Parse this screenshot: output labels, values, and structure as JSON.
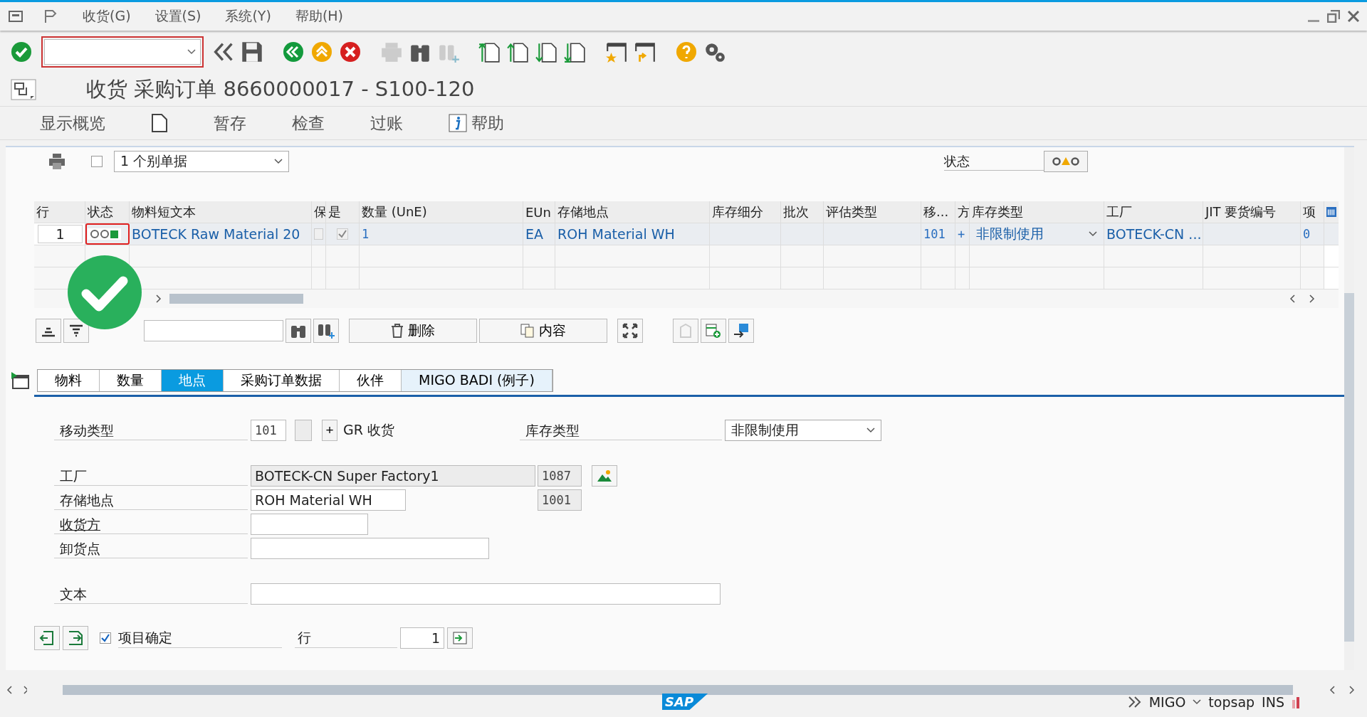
{
  "menu": [
    "收货(G)",
    "设置(S)",
    "系统(Y)",
    "帮助(H)"
  ],
  "title": "收货 采购订单 8660000017 - S100-120",
  "app_toolbar": [
    {
      "kind": "text",
      "label": "显示概览"
    },
    {
      "kind": "doc"
    },
    {
      "kind": "text",
      "label": "暂存"
    },
    {
      "kind": "text",
      "label": "检查"
    },
    {
      "kind": "text",
      "label": "过账"
    },
    {
      "kind": "help",
      "label": "帮助"
    }
  ],
  "header": {
    "print_checkbox": {
      "checked": false
    },
    "document_select": "1 个别单据",
    "status_label": "状态"
  },
  "table": {
    "columns": [
      "行",
      "状态",
      "物料短文本",
      "保",
      "是",
      "数量 (UnE)",
      "EUn",
      "存储地点",
      "库存细分",
      "批次",
      "评估类型",
      "移...",
      "方",
      "库存类型",
      "工厂",
      "JIT 要货编号",
      "项"
    ],
    "rows": [
      {
        "cells": [
          {
            "kind": "num",
            "text": "1"
          },
          {
            "kind": "status",
            "color": "#1a9a3a"
          },
          {
            "kind": "link",
            "text": "BOTECK Raw Material 20"
          },
          {
            "kind": "check",
            "checked": false
          },
          {
            "kind": "check",
            "checked": true
          },
          {
            "kind": "value",
            "text": "1"
          },
          {
            "kind": "link",
            "text": "EA"
          },
          {
            "kind": "link",
            "text": "ROH Material WH"
          },
          {
            "kind": "blank"
          },
          {
            "kind": "blank"
          },
          {
            "kind": "blank"
          },
          {
            "kind": "value",
            "text": "101"
          },
          {
            "kind": "value",
            "text": "+"
          },
          {
            "kind": "dropdown",
            "text": "非限制使用"
          },
          {
            "kind": "link",
            "text": "BOTECK-CN ..."
          },
          {
            "kind": "blank"
          },
          {
            "kind": "value",
            "text": "0"
          }
        ]
      }
    ]
  },
  "table_toolbar": [
    "删除",
    "内容"
  ],
  "tabs": [
    {
      "label": "物料",
      "selected": false
    },
    {
      "label": "数量",
      "selected": false
    },
    {
      "label": "地点",
      "selected": true
    },
    {
      "label": "采购订单数据",
      "selected": false
    },
    {
      "label": "伙伴",
      "selected": false
    },
    {
      "label": "MIGO BADI (例子)",
      "selected": false
    }
  ],
  "form": {
    "movement_type": {
      "label": "移动类型",
      "value": "101",
      "indicator": "+",
      "description": "GR 收货"
    },
    "stock_type": {
      "label": "库存类型",
      "value": "非限制使用"
    },
    "plant": {
      "label": "工厂",
      "value": "BOTECK-CN Super Factory1",
      "code": "1087"
    },
    "storage_location": {
      "label": "存储地点",
      "value": "ROH Material WH",
      "code": "1001"
    },
    "goods_recipient": {
      "label": "收货方"
    },
    "unloading_point": {
      "label": "卸货点"
    },
    "text": {
      "label": "文本"
    }
  },
  "footer": {
    "item_ok": {
      "label": "项目确定",
      "checked": true
    },
    "line_label": "行",
    "line_value": "1"
  },
  "status_bar": {
    "logo": "SAP",
    "transaction": "MIGO",
    "server": "topsap",
    "mode": "INS"
  }
}
